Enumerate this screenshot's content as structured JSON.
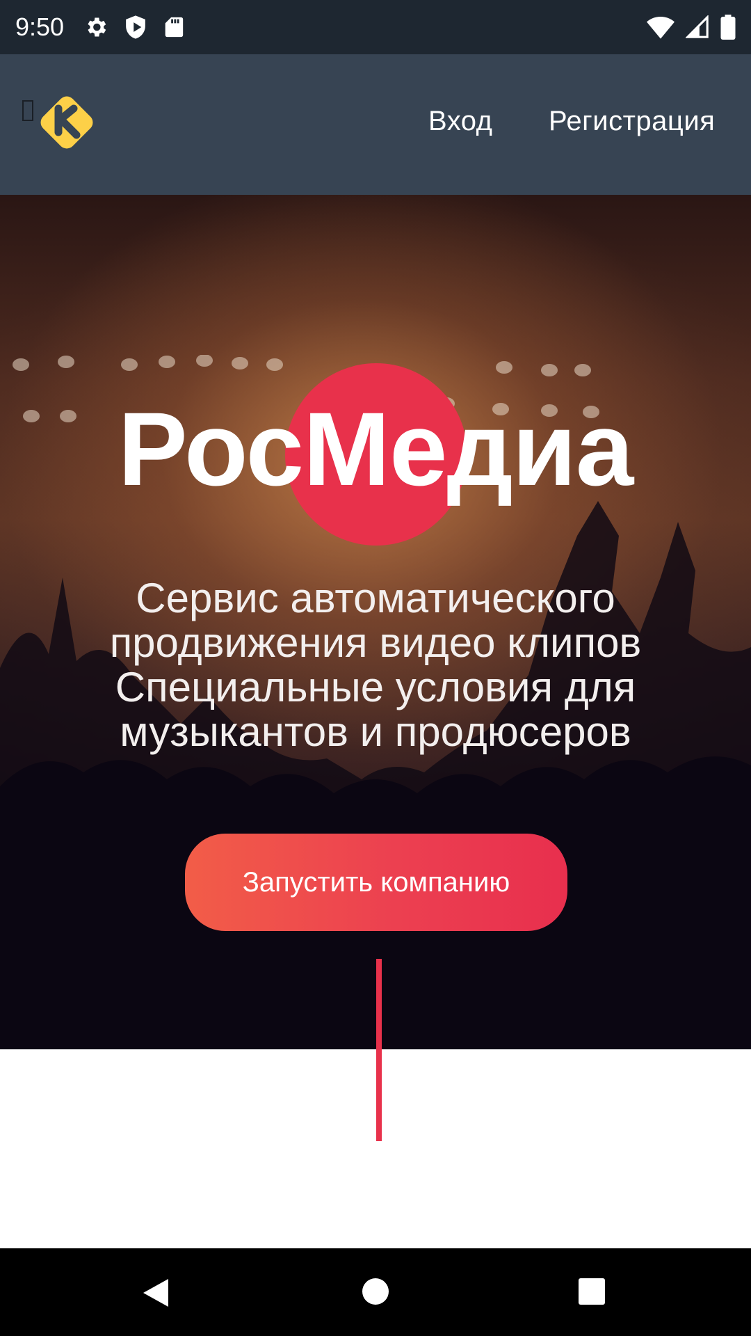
{
  "status_bar": {
    "time": "9:50",
    "icons_left": [
      "settings-icon",
      "shield-icon",
      "sd-card-icon"
    ],
    "icons_right": [
      "wifi-icon",
      "signal-icon",
      "battery-icon"
    ]
  },
  "header": {
    "logo": "rocket-style-logo",
    "logo_color": "#fdd048",
    "background": "#374453",
    "nav": {
      "login": "Вход",
      "register": "Регистрация"
    }
  },
  "hero": {
    "title": "РосМедиа",
    "accent_color": "#e8314b",
    "tagline": [
      "Сервис автоматического",
      "продвижения видео клипов",
      "Специальные условия для",
      "музыкантов и продюсеров"
    ],
    "cta": "Запустить компанию"
  },
  "nav_bar": {
    "icons": [
      "back-icon",
      "home-icon",
      "recent-apps-icon"
    ]
  }
}
